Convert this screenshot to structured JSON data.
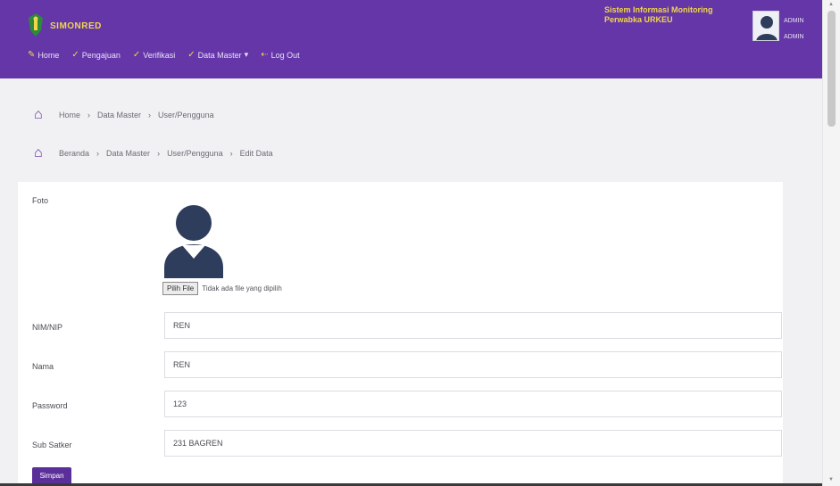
{
  "app": {
    "name": "SIMONRED"
  },
  "nav": [
    {
      "label": "Home",
      "icon": "pen-icon"
    },
    {
      "label": "Pengajuan",
      "icon": "check-icon"
    },
    {
      "label": "Verifikasi",
      "icon": "check-icon"
    },
    {
      "label": "Data Master",
      "icon": "check-icon",
      "caret": "▾"
    },
    {
      "label": "Log Out",
      "icon": "logout-icon"
    }
  ],
  "header": {
    "system_title": "Sistem Informasi Monitoring Perwabka URKEU",
    "user_name": "ADMIN",
    "user_role": "ADMIN"
  },
  "breadcrumb1": [
    "Home",
    "Data Master",
    "User/Pengguna"
  ],
  "breadcrumb2": [
    "Beranda",
    "Data Master",
    "User/Pengguna",
    "Edit Data"
  ],
  "form": {
    "foto_label": "Foto",
    "file_button": "Pilih File",
    "file_status": "Tidak ada file yang dipilih",
    "nip_label": "NIM/NIP",
    "nip_value": "REN",
    "nama_label": "Nama",
    "nama_value": "REN",
    "password_label": "Password",
    "password_value": "123",
    "subsatker_label": "Sub Satker",
    "subsatker_value": "231 BAGREN",
    "save_label": "Simpan"
  },
  "colors": {
    "header": "#6436a8",
    "accent": "#f2d64a",
    "button": "#5a2f9a"
  }
}
